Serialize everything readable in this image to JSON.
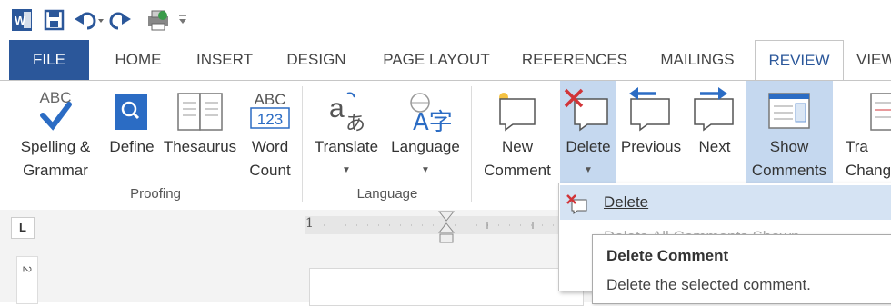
{
  "tabs": [
    "FILE",
    "HOME",
    "INSERT",
    "DESIGN",
    "PAGE LAYOUT",
    "REFERENCES",
    "MAILINGS",
    "REVIEW",
    "VIEW"
  ],
  "proofing": {
    "spelling": {
      "line1": "Spelling &",
      "line2": "Grammar",
      "icon_text": "ABC"
    },
    "define": {
      "line1": "Define"
    },
    "thesaurus": {
      "line1": "Thesaurus"
    },
    "wordcount": {
      "line1": "Word",
      "line2": "Count",
      "icon_text1": "ABC",
      "icon_text2": "123"
    },
    "group_label": "Proofing"
  },
  "language": {
    "translate": {
      "line1": "Translate",
      "icon_text1": "a",
      "icon_text2": "あ"
    },
    "language": {
      "line1": "Language",
      "icon_text": "A字"
    },
    "group_label": "Language"
  },
  "comments": {
    "new": {
      "line1": "New",
      "line2": "Comment"
    },
    "delete": {
      "line1": "Delete"
    },
    "previous": {
      "line1": "Previous"
    },
    "next": {
      "line1": "Next"
    },
    "show": {
      "line1": "Show",
      "line2": "Comments"
    },
    "track": {
      "line1": "Tra",
      "line2": "Chang"
    }
  },
  "ruler": {
    "marker": "1",
    "corner": "L",
    "vmark": "2"
  },
  "menu": {
    "items": [
      "Delete",
      "Delete All Comments Shown"
    ]
  },
  "tooltip": {
    "title": "Delete Comment",
    "desc": "Delete the selected comment."
  },
  "colors": {
    "accent": "#2b579a",
    "highlight": "#c5d8ef",
    "check": "#2b6cc4"
  }
}
